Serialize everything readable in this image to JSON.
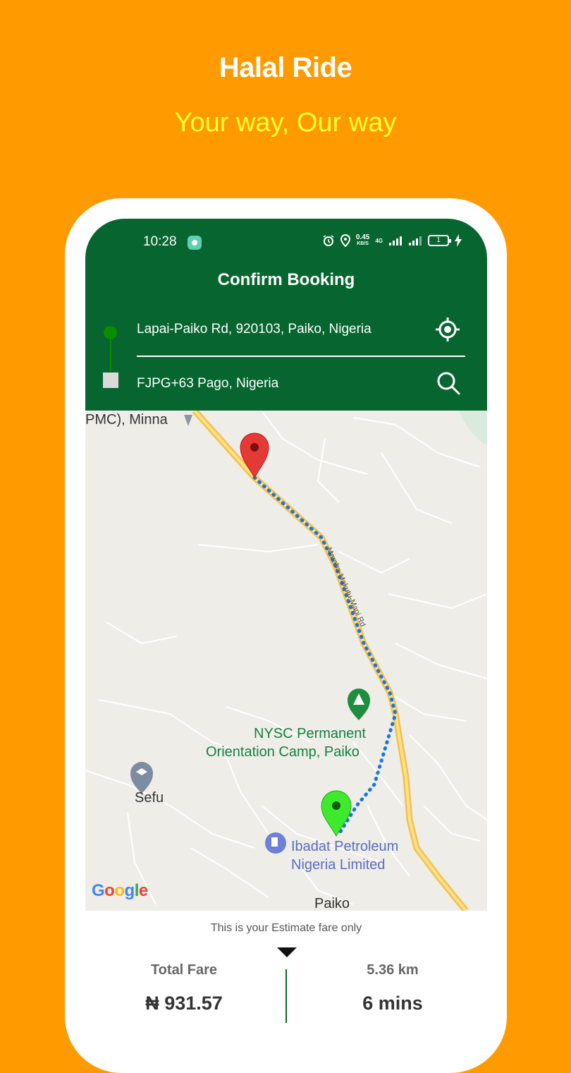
{
  "promo": {
    "title": "Halal Ride",
    "subtitle": "Your way, Our way"
  },
  "status_bar": {
    "time": "10:28",
    "speed": "0.45",
    "speed_unit": "KB/S",
    "network": "4G",
    "battery": "1"
  },
  "header": {
    "title": "Confirm Booking",
    "pickup": "Lapai-Paiko Rd, 920103, Paiko, Nigeria",
    "dropoff": "FJPG+63 Pago, Nigeria"
  },
  "map": {
    "labels": {
      "minna": "PMC), Minna",
      "road": "Maraba-Makutu-Mapi Rd",
      "nysc_line1": "NYSC Permanent",
      "nysc_line2": "Orientation Camp, Paiko",
      "sefu": "Sefu",
      "petrol_line1": "Ibadat Petroleum",
      "petrol_line2": "Nigeria Limited",
      "paiko": "Paiko",
      "google": "Google"
    },
    "colors": {
      "route": "#1A73E8",
      "destination_marker": "#E53935",
      "origin_marker": "#3EEB2C"
    }
  },
  "fare": {
    "note": "This is your Estimate fare only",
    "total_label": "Total Fare",
    "total_value": "₦ 931.57",
    "distance": "5.36 km",
    "duration": "6 mins"
  },
  "colors": {
    "background": "#FF9B00",
    "header": "#07652F",
    "subtitle": "#FFFF33"
  }
}
